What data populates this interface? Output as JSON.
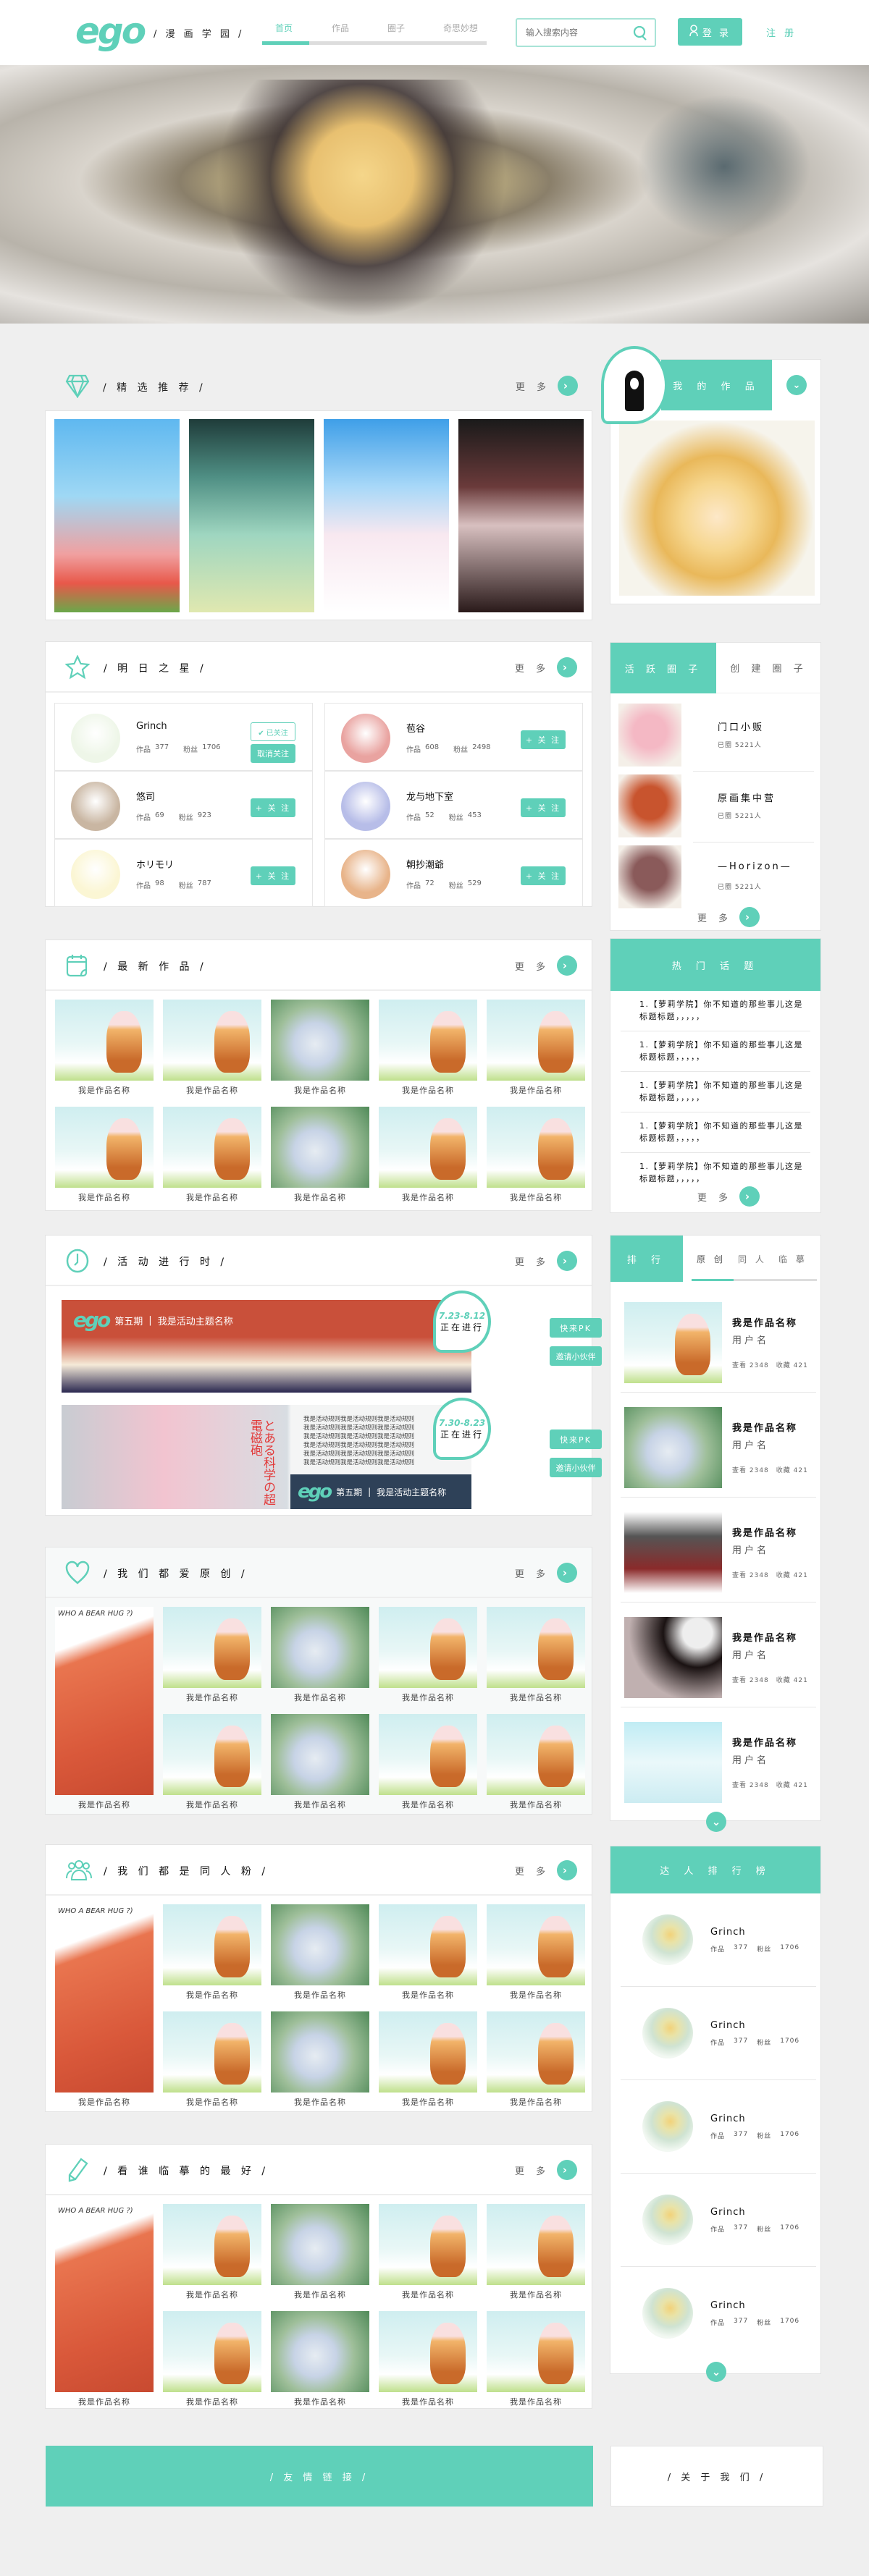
{
  "header": {
    "logo": "ego",
    "site_name": "/ 漫 画 学 园 /",
    "nav": [
      "首页",
      "作品",
      "圈子",
      "奇思妙想"
    ],
    "active_nav": 0,
    "nav_progress": 0.21,
    "search_placeholder": "输入搜索内容",
    "login": "登 录",
    "register": "注 册"
  },
  "banner": {
    "slide_count": 3,
    "active_slide": 0
  },
  "featured": {
    "title": "/ 精 选 推 荐 /",
    "more": "更 多"
  },
  "stars": {
    "title": "/ 明 日 之 星 /",
    "more": "更 多",
    "works_label": "作品",
    "fans_label": "粉丝",
    "followed_label": "✔ 已关注",
    "unfollow_label": "取消关注",
    "follow_label": "+ 关 注",
    "users": [
      {
        "name": "Grinch",
        "works": "377",
        "fans": "1706",
        "followed": true,
        "color": "#eef6e8"
      },
      {
        "name": "苞谷",
        "works": "608",
        "fans": "2498",
        "followed": false,
        "color": "#e9a3a0"
      },
      {
        "name": "悠司",
        "works": "69",
        "fans": "923",
        "followed": false,
        "color": "#c9b6a2"
      },
      {
        "name": "龙与地下室",
        "works": "52",
        "fans": "453",
        "followed": false,
        "color": "#b7bde8"
      },
      {
        "name": "ホリモリ",
        "works": "98",
        "fans": "787",
        "followed": false,
        "color": "#fbf6d4"
      },
      {
        "name": "朝抄潮爺",
        "works": "72",
        "fans": "529",
        "followed": false,
        "color": "#e8b48a"
      }
    ]
  },
  "latest": {
    "title": "/ 最 新 作 品 /",
    "more": "更 多",
    "works": [
      "我是作品名称",
      "我是作品名称",
      "我是作品名称",
      "我是作品名称",
      "我是作品名称",
      "我是作品名称",
      "我是作品名称",
      "我是作品名称",
      "我是作品名称",
      "我是作品名称"
    ]
  },
  "events": {
    "title": "/ 活 动 进 行 时 /",
    "more": "更 多",
    "items": [
      {
        "logo": "ego",
        "issue": "第五期",
        "theme": "我是活动主题名称",
        "dates": "7.23-8.12",
        "status": "正在进行",
        "pk": "快来PK",
        "invite": "邀请小伙伴"
      },
      {
        "logo": "ego",
        "issue": "第五期",
        "theme": "我是活动主题名称",
        "dates": "7.30-8.23",
        "status": "正在进行",
        "pk": "快来PK",
        "invite": "邀请小伙伴",
        "art_title": "とある科学の超電磁砲",
        "rules": [
          "我是活动规则我是活动规则我是活动规则",
          "我是活动规则我是活动规则我是活动规则",
          "我是活动规则我是活动规则我是活动规则",
          "我是活动规则我是活动规则我是活动规则",
          "我是活动规则我是活动规则我是活动规则",
          "我是活动规则我是活动规则我是活动规则"
        ]
      }
    ]
  },
  "original": {
    "title": "/ 我 们 都 爱 原 创 /",
    "more": "更 多",
    "feature_text": "WHO A BEAR HUG ?)",
    "works": [
      "我是作品名称",
      "我是作品名称",
      "我是作品名称",
      "我是作品名称",
      "我是作品名称",
      "我是作品名称",
      "我是作品名称",
      "我是作品名称",
      "我是作品名称"
    ]
  },
  "fan": {
    "title": "/ 我 们 都 是 同 人 粉 /",
    "more": "更 多",
    "feature_text": "WHO A BEAR HUG ?)",
    "works": [
      "我是作品名称",
      "我是作品名称",
      "我是作品名称",
      "我是作品名称",
      "我是作品名称",
      "我是作品名称",
      "我是作品名称",
      "我是作品名称",
      "我是作品名称"
    ]
  },
  "copy": {
    "title": "/ 看 谁 临 摹 的 最 好 /",
    "more": "更 多",
    "feature_text": "WHO A BEAR HUG ?)",
    "works": [
      "我是作品名称",
      "我是作品名称",
      "我是作品名称",
      "我是作品名称",
      "我是作品名称",
      "我是作品名称",
      "我是作品名称",
      "我是作品名称",
      "我是作品名称"
    ]
  },
  "sidebar": {
    "my_works": {
      "title": "我 的 作 品"
    },
    "circles": {
      "tabs": [
        "活 跃 圈 子",
        "创 建 圈 子"
      ],
      "items": [
        {
          "name": "门口小贩",
          "count": "已圈  5221人",
          "color": "#f4b8c4"
        },
        {
          "name": "原画集中营",
          "count": "已圈  5221人",
          "color": "#c8542e"
        },
        {
          "name": "—Horizon—",
          "count": "已圈  5221人",
          "color": "#8a5a5a"
        }
      ],
      "more": "更 多"
    },
    "topics": {
      "title": "热 门 话 题",
      "items": [
        "1.【萝莉学院】你不知道的那些事儿这是标题标题，，，，，",
        "1.【萝莉学院】你不知道的那些事儿这是标题标题，，，，，",
        "1.【萝莉学院】你不知道的那些事儿这是标题标题，，，，，",
        "1.【萝莉学院】你不知道的那些事儿这是标题标题，，，，，",
        "1.【萝莉学院】你不知道的那些事儿这是标题标题，，，，，"
      ],
      "more": "更 多"
    },
    "ranking": {
      "title": "排 行",
      "tabs": [
        "原 创",
        "同 人",
        "临 摹"
      ],
      "active_tab": 0,
      "items": [
        {
          "title": "我是作品名称",
          "user": "用户名",
          "views": "查看 2348",
          "favs": "收藏 421"
        },
        {
          "title": "我是作品名称",
          "user": "用户名",
          "views": "查看 2348",
          "favs": "收藏 421"
        },
        {
          "title": "我是作品名称",
          "user": "用户名",
          "views": "查看 2348",
          "favs": "收藏 421"
        },
        {
          "title": "我是作品名称",
          "user": "用户名",
          "views": "查看 2348",
          "favs": "收藏 421"
        },
        {
          "title": "我是作品名称",
          "user": "用户名",
          "views": "查看 2348",
          "favs": "收藏 421"
        }
      ]
    },
    "experts": {
      "title": "达 人 排 行 榜",
      "works_label": "作品",
      "fans_label": "粉丝",
      "items": [
        {
          "name": "Grinch",
          "works": "377",
          "fans": "1706"
        },
        {
          "name": "Grinch",
          "works": "377",
          "fans": "1706"
        },
        {
          "name": "Grinch",
          "works": "377",
          "fans": "1706"
        },
        {
          "name": "Grinch",
          "works": "377",
          "fans": "1706"
        },
        {
          "name": "Grinch",
          "works": "377",
          "fans": "1706"
        }
      ]
    }
  },
  "footer": {
    "links": "/ 友 情 链 接 /",
    "about": "/ 关 于 我 们 /"
  },
  "colors": {
    "accent": "#5fd0b9",
    "background": "#efefef"
  }
}
